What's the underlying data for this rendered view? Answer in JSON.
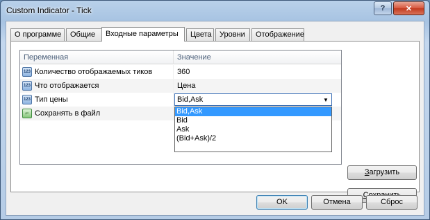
{
  "window": {
    "title": "Custom Indicator - Tick",
    "help_label": "?",
    "close_label": "✕"
  },
  "tabs": [
    {
      "label": "О программе"
    },
    {
      "label": "Общие"
    },
    {
      "label": "Входные параметры",
      "active": true
    },
    {
      "label": "Цвета"
    },
    {
      "label": "Уровни"
    },
    {
      "label": "Отображение"
    }
  ],
  "grid": {
    "headers": {
      "name": "Переменная",
      "value": "Значение"
    },
    "rows": [
      {
        "icon": "123-icon",
        "icon_text": "123",
        "name": "Количество отображаемых тиков",
        "value": "360"
      },
      {
        "icon": "123-icon",
        "icon_text": "123",
        "name": "Что отображается",
        "value": "Цена"
      },
      {
        "icon": "123-icon",
        "icon_text": "123",
        "name": "Тип цены",
        "value": "Bid,Ask"
      },
      {
        "icon": "bool-icon",
        "icon_text": "⌐",
        "name": "Сохранять в файл",
        "value": ""
      }
    ]
  },
  "dropdown": {
    "selected": "Bid,Ask",
    "options": [
      "Bid,Ask",
      "Bid",
      "Ask",
      "(Bid+Ask)/2"
    ]
  },
  "side_buttons": {
    "load_prefix": "З",
    "load_rest": "агрузить",
    "save_prefix": "С",
    "save_rest": "охранить"
  },
  "footer": {
    "ok": "OK",
    "cancel": "Отмена",
    "reset": "Сброс"
  }
}
